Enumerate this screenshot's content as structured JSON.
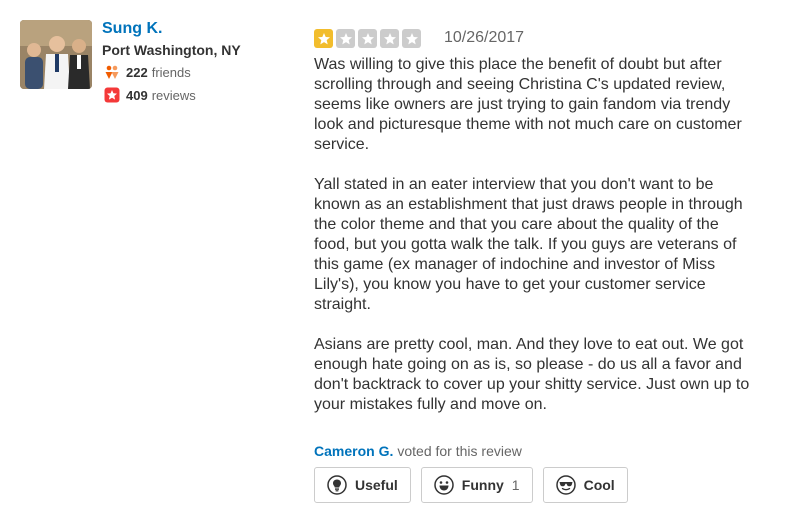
{
  "reviewer": {
    "name": "Sung K.",
    "location": "Port Washington, NY",
    "friends_count": "222",
    "friends_label": "friends",
    "reviews_count": "409",
    "reviews_label": "reviews"
  },
  "review": {
    "rating": 1,
    "rating_max": 5,
    "date": "10/26/2017",
    "paragraphs": [
      "Was willing to give this place the benefit of doubt but after scrolling through and seeing Christina C's updated review, seems like owners are just trying to gain fandom via trendy look and picturesque theme with not much care on customer service.",
      "Yall stated in an eater interview that you don't want to be known as an establishment that just draws people in through the color theme and that you care about the quality of the food, but you gotta walk the talk. If you guys are veterans of this game (ex manager of indochine and investor of Miss Lily's), you know you have to get your customer service straight.",
      "Asians are pretty cool, man. And they love to eat out. We got enough hate going on as is, so please - do us all a favor and don't backtrack to cover up your shitty service. Just own up to your mistakes fully and move on."
    ]
  },
  "votes": {
    "voter_name": "Cameron G.",
    "voter_text": "voted for this review",
    "useful_label": "Useful",
    "funny_label": "Funny",
    "funny_count": "1",
    "cool_label": "Cool"
  },
  "icons": {
    "friends": "friends-icon",
    "reviews": "review-star-icon",
    "useful": "lightbulb-icon",
    "funny": "smiley-icon",
    "cool": "sunglasses-icon"
  },
  "colors": {
    "link_blue": "#0073bb",
    "star_filled": "#f2bd2d",
    "star_empty": "#cccccc",
    "friends_orange": "#f15c00",
    "reviews_red": "#f43939"
  }
}
